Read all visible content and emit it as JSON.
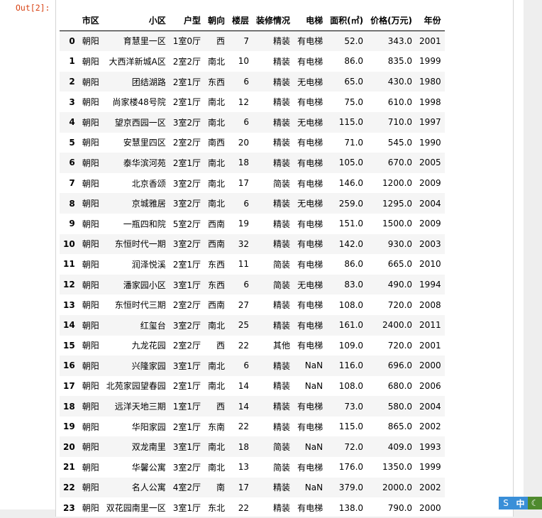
{
  "prompt": "Out[2]:",
  "columns": [
    "",
    "市区",
    "小区",
    "户型",
    "朝向",
    "楼层",
    "装修情况",
    "电梯",
    "面积(㎡)",
    "价格(万元)",
    "年份"
  ],
  "rows": [
    [
      "0",
      "朝阳",
      "育慧里一区",
      "1室0厅",
      "西",
      "7",
      "精装",
      "有电梯",
      "52.0",
      "343.0",
      "2001"
    ],
    [
      "1",
      "朝阳",
      "大西洋新城A区",
      "2室2厅",
      "南北",
      "10",
      "精装",
      "有电梯",
      "86.0",
      "835.0",
      "1999"
    ],
    [
      "2",
      "朝阳",
      "团结湖路",
      "2室1厅",
      "东西",
      "6",
      "精装",
      "无电梯",
      "65.0",
      "430.0",
      "1980"
    ],
    [
      "3",
      "朝阳",
      "尚家楼48号院",
      "2室1厅",
      "南北",
      "12",
      "精装",
      "有电梯",
      "75.0",
      "610.0",
      "1998"
    ],
    [
      "4",
      "朝阳",
      "望京西园一区",
      "3室2厅",
      "南北",
      "6",
      "精装",
      "无电梯",
      "115.0",
      "710.0",
      "1997"
    ],
    [
      "5",
      "朝阳",
      "安慧里四区",
      "2室2厅",
      "南西",
      "20",
      "精装",
      "有电梯",
      "71.0",
      "545.0",
      "1990"
    ],
    [
      "6",
      "朝阳",
      "泰华滨河苑",
      "2室1厅",
      "南北",
      "18",
      "精装",
      "有电梯",
      "105.0",
      "670.0",
      "2005"
    ],
    [
      "7",
      "朝阳",
      "北京香颂",
      "3室2厅",
      "南北",
      "17",
      "简装",
      "有电梯",
      "146.0",
      "1200.0",
      "2009"
    ],
    [
      "8",
      "朝阳",
      "京城雅居",
      "3室2厅",
      "南北",
      "6",
      "精装",
      "无电梯",
      "259.0",
      "1295.0",
      "2004"
    ],
    [
      "9",
      "朝阳",
      "一瓶四和院",
      "5室2厅",
      "西南",
      "19",
      "精装",
      "有电梯",
      "151.0",
      "1500.0",
      "2009"
    ],
    [
      "10",
      "朝阳",
      "东恒时代一期",
      "3室2厅",
      "西南",
      "32",
      "精装",
      "有电梯",
      "142.0",
      "930.0",
      "2003"
    ],
    [
      "11",
      "朝阳",
      "润泽悦溪",
      "2室1厅",
      "东西",
      "11",
      "简装",
      "有电梯",
      "86.0",
      "665.0",
      "2010"
    ],
    [
      "12",
      "朝阳",
      "潘家园小区",
      "3室1厅",
      "东西",
      "6",
      "简装",
      "无电梯",
      "83.0",
      "490.0",
      "1994"
    ],
    [
      "13",
      "朝阳",
      "东恒时代三期",
      "2室2厅",
      "西南",
      "27",
      "精装",
      "有电梯",
      "108.0",
      "720.0",
      "2008"
    ],
    [
      "14",
      "朝阳",
      "红玺台",
      "3室2厅",
      "南北",
      "25",
      "精装",
      "有电梯",
      "161.0",
      "2400.0",
      "2011"
    ],
    [
      "15",
      "朝阳",
      "九龙花园",
      "2室2厅",
      "西",
      "22",
      "其他",
      "有电梯",
      "109.0",
      "720.0",
      "2001"
    ],
    [
      "16",
      "朝阳",
      "兴隆家园",
      "3室1厅",
      "南北",
      "6",
      "精装",
      "NaN",
      "116.0",
      "696.0",
      "2000"
    ],
    [
      "17",
      "朝阳",
      "北苑家园望春园",
      "2室1厅",
      "南北",
      "14",
      "精装",
      "NaN",
      "108.0",
      "680.0",
      "2006"
    ],
    [
      "18",
      "朝阳",
      "远洋天地三期",
      "1室1厅",
      "西",
      "14",
      "精装",
      "有电梯",
      "73.0",
      "580.0",
      "2004"
    ],
    [
      "19",
      "朝阳",
      "华阳家园",
      "2室1厅",
      "东南",
      "22",
      "精装",
      "有电梯",
      "115.0",
      "865.0",
      "2002"
    ],
    [
      "20",
      "朝阳",
      "双龙南里",
      "3室1厅",
      "南北",
      "18",
      "简装",
      "NaN",
      "72.0",
      "409.0",
      "1993"
    ],
    [
      "21",
      "朝阳",
      "华馨公寓",
      "3室2厅",
      "南北",
      "13",
      "简装",
      "有电梯",
      "176.0",
      "1350.0",
      "1999"
    ],
    [
      "22",
      "朝阳",
      "名人公寓",
      "4室2厅",
      "南",
      "17",
      "精装",
      "NaN",
      "379.0",
      "2000.0",
      "2002"
    ],
    [
      "23",
      "朝阳",
      "双花园南里一区",
      "3室1厅",
      "东北",
      "22",
      "精装",
      "有电梯",
      "138.0",
      "790.0",
      "2000"
    ]
  ],
  "status_widget": [
    "S",
    "中",
    "☾"
  ]
}
